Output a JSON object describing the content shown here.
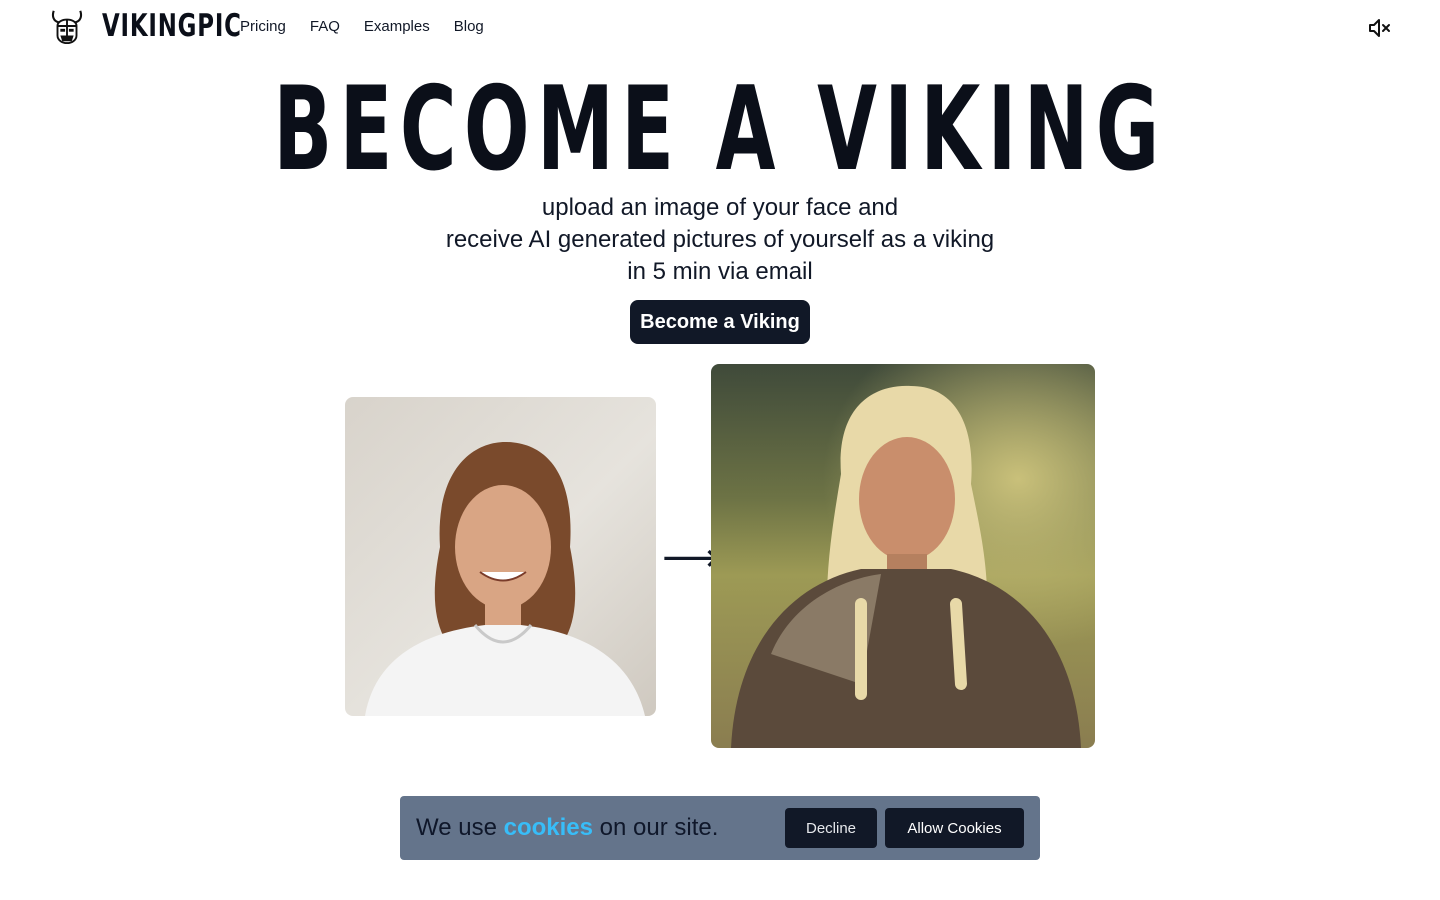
{
  "nav": {
    "brand": "VIKINGPIC",
    "logo_icon": "viking-helmet-icon",
    "items": [
      {
        "label": "Pricing"
      },
      {
        "label": "FAQ"
      },
      {
        "label": "Examples"
      },
      {
        "label": "Blog"
      }
    ],
    "mute_icon": "speaker-muted-icon"
  },
  "hero": {
    "title": "BECOME A VIKING",
    "subtitle_lines": [
      "upload an image of your face and",
      "receive AI generated pictures of yourself as a viking",
      "in 5 min via email"
    ],
    "cta_label": "Become a Viking",
    "arrow": "⟶"
  },
  "cookie_banner": {
    "text_before": "We use ",
    "link_text": "cookies",
    "text_after": " on our site.",
    "decline_label": "Decline",
    "allow_label": "Allow Cookies"
  },
  "colors": {
    "primary": "#111827",
    "banner_bg": "#64748b",
    "link": "#38bdf8"
  }
}
